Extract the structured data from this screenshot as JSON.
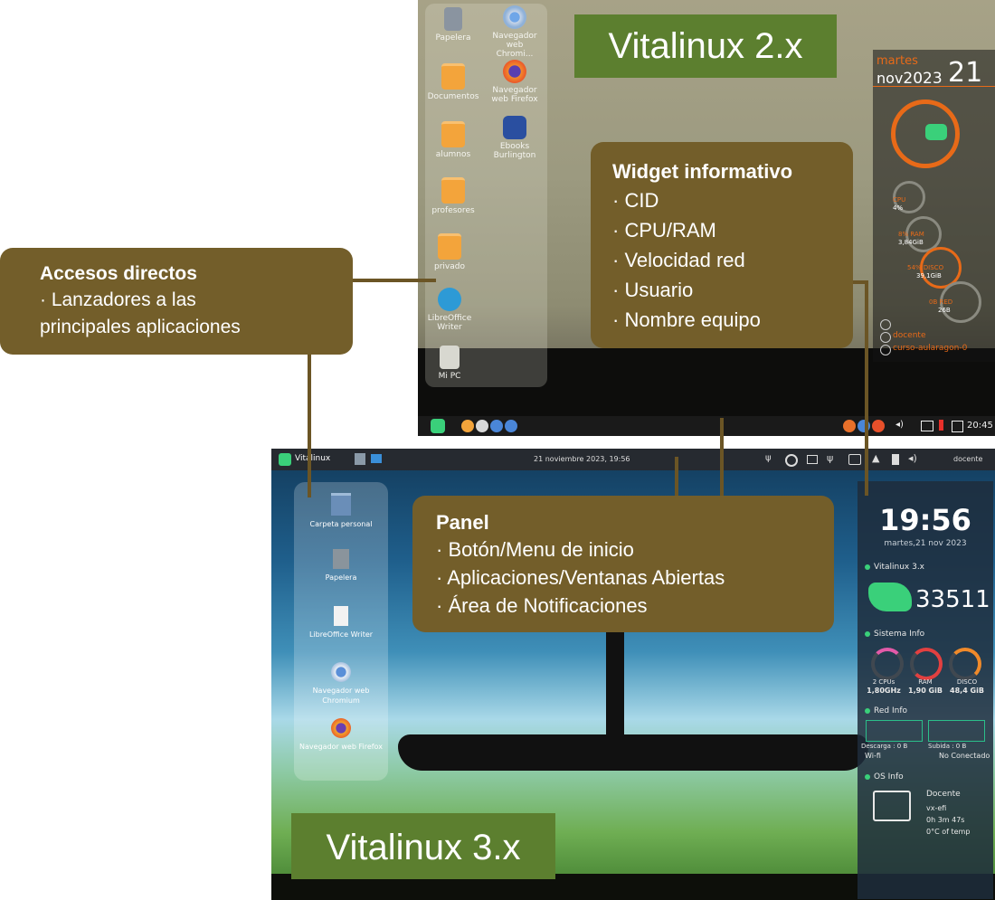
{
  "desktop2": {
    "title": "Vitalinux 2.x",
    "icons": [
      {
        "label": "Papelera",
        "icon": "trash-icon"
      },
      {
        "label": "Navegador web Chromi...",
        "icon": "chromium-icon"
      },
      {
        "label": "Documentos",
        "icon": "folder-icon"
      },
      {
        "label": "Navegador web Firefox",
        "icon": "firefox-icon"
      },
      {
        "label": "alumnos",
        "icon": "folder-icon"
      },
      {
        "label": "Ebooks Burlington",
        "icon": "ebooks-icon"
      },
      {
        "label": "profesores",
        "icon": "folder-icon"
      },
      {
        "label": "privado",
        "icon": "folder-icon"
      },
      {
        "label": "LibreOffice Writer",
        "icon": "writer-icon"
      },
      {
        "label": "Mi PC",
        "icon": "computer-icon"
      }
    ],
    "conky": {
      "day": "martes",
      "month": "nov",
      "year": "2023",
      "date": "21",
      "cpu_label": "CPU",
      "cpu_value": "4%",
      "ram_label": "8% RAM",
      "ram_value": "3,84GiB",
      "disk_label": "54% DISCO",
      "disk_value": "39,1GiB",
      "net_label": "0B RED",
      "net_value": "26B",
      "user": "docente",
      "host": "curso-aularagon-0"
    },
    "taskbar_clock": "20:45"
  },
  "callouts": {
    "widget": {
      "heading": "Widget informativo",
      "lines": [
        "· CID",
        "· CPU/RAM",
        "· Velocidad red",
        "· Usuario",
        "· Nombre equipo"
      ]
    },
    "shortcuts": {
      "heading": "Accesos directos",
      "lines": [
        "· Lanzadores a las",
        "principales aplicaciones"
      ]
    },
    "panel": {
      "heading": "Panel",
      "lines": [
        "· Botón/Menu de inicio",
        "· Aplicaciones/Ventanas Abiertas",
        "· Área de Notificaciones"
      ]
    }
  },
  "desktop3": {
    "title": "Vitalinux 3.x",
    "topbar": {
      "brand": "Vitalinux",
      "datetime": "21 noviembre 2023, 19:56",
      "user": "docente"
    },
    "icons": [
      {
        "label": "Carpeta personal",
        "icon": "home-folder-icon"
      },
      {
        "label": "Papelera",
        "icon": "trash-icon"
      },
      {
        "label": "LibreOffice Writer",
        "icon": "writer-icon"
      },
      {
        "label": "Navegador web Chromium",
        "icon": "chromium-icon"
      },
      {
        "label": "Navegador web Firefox",
        "icon": "firefox-icon"
      }
    ],
    "side": {
      "clock": "19:56",
      "date": "martes,21 nov 2023",
      "vitalinux_title": "Vitalinux 3.x",
      "cid": "33511",
      "sys_title": "Sistema Info",
      "cpu_label": "2 CPUs",
      "cpu_value": "1,80GHz",
      "ram_label": "RAM",
      "ram_value": "1,90 GiB",
      "disk_label": "DISCO",
      "disk_value": "48,4 GiB",
      "net_title": "Red Info",
      "download": "Descarga : 0 B",
      "upload": "Subida : 0 B",
      "wifi": "Wi-fi",
      "net_status": "No Conectado",
      "os_title": "OS Info",
      "os_user": "Docente",
      "os_kernel": "vx-efi",
      "os_uptime": "0h 3m 47s",
      "os_temp": "0°C of temp"
    }
  },
  "colors": {
    "callout_bg": "#735e2a",
    "title_badge": "#5c7f2f",
    "accent_orange": "#e86a18",
    "accent_green": "#3ad07a"
  }
}
